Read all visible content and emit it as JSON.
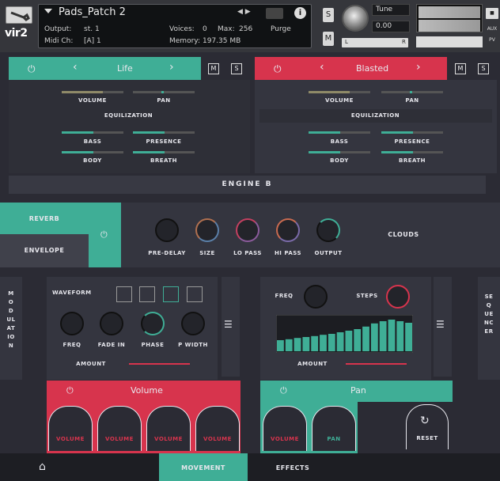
{
  "header": {
    "patch_name": "Pads_Patch 2",
    "output_label": "Output:",
    "output_value": "st. 1",
    "voices_label": "Voices:",
    "voices_value": "0",
    "max_label": "Max:",
    "max_value": "256",
    "purge": "Purge",
    "midi_label": "Midi Ch:",
    "midi_value": "[A] 1",
    "memory_label": "Memory:",
    "memory_value": "197.35 MB",
    "tune_label": "Tune",
    "tune_value": "0.00",
    "solo": "S",
    "mute": "M",
    "logo": "vir2",
    "aux": "AUX",
    "pv": "PV",
    "left": "L",
    "right": "R"
  },
  "layers": [
    {
      "name": "Life",
      "color": "#3fae96",
      "m": "M",
      "s": "S",
      "volume": "VOLUME",
      "pan": "PAN",
      "eq": "EQUILIZATION",
      "bass": "BASS",
      "presence": "PRESENCE",
      "body": "BODY",
      "breath": "BREATH"
    },
    {
      "name": "Blasted",
      "color": "#d7344d",
      "m": "M",
      "s": "S",
      "volume": "VOLUME",
      "pan": "PAN",
      "eq": "EQUILIZATION",
      "bass": "BASS",
      "presence": "PRESENCE",
      "body": "BODY",
      "breath": "BREATH"
    }
  ],
  "engine": "ENGINE B",
  "fx": {
    "reverb": "REVERB",
    "envelope": "ENVELOPE",
    "knobs": [
      "PRE-DELAY",
      "SIZE",
      "LO PASS",
      "HI PASS",
      "OUTPUT"
    ],
    "preset": "CLOUDS"
  },
  "modulation": {
    "side": "MODULATION",
    "waveform": "WAVEFORM",
    "knobs": [
      "FREQ",
      "FADE IN",
      "PHASE",
      "P WIDTH"
    ],
    "amount": "AMOUNT",
    "target": "Volume"
  },
  "sequencer": {
    "side": "SEQUENCER",
    "freq": "FREQ",
    "steps": "STEPS",
    "amount": "AMOUNT",
    "target": "Pan",
    "step_values": [
      0.35,
      0.38,
      0.42,
      0.45,
      0.48,
      0.52,
      0.55,
      0.6,
      0.65,
      0.7,
      0.78,
      0.88,
      0.95,
      1.0,
      0.95,
      0.9
    ]
  },
  "tabs": {
    "mod": [
      "VOLUME",
      "VOLUME",
      "VOLUME",
      "VOLUME"
    ],
    "seq": [
      "VOLUME",
      "PAN"
    ],
    "reset": "RESET"
  },
  "footer": {
    "movement": "MOVEMENT",
    "effects": "EFFECTS"
  }
}
